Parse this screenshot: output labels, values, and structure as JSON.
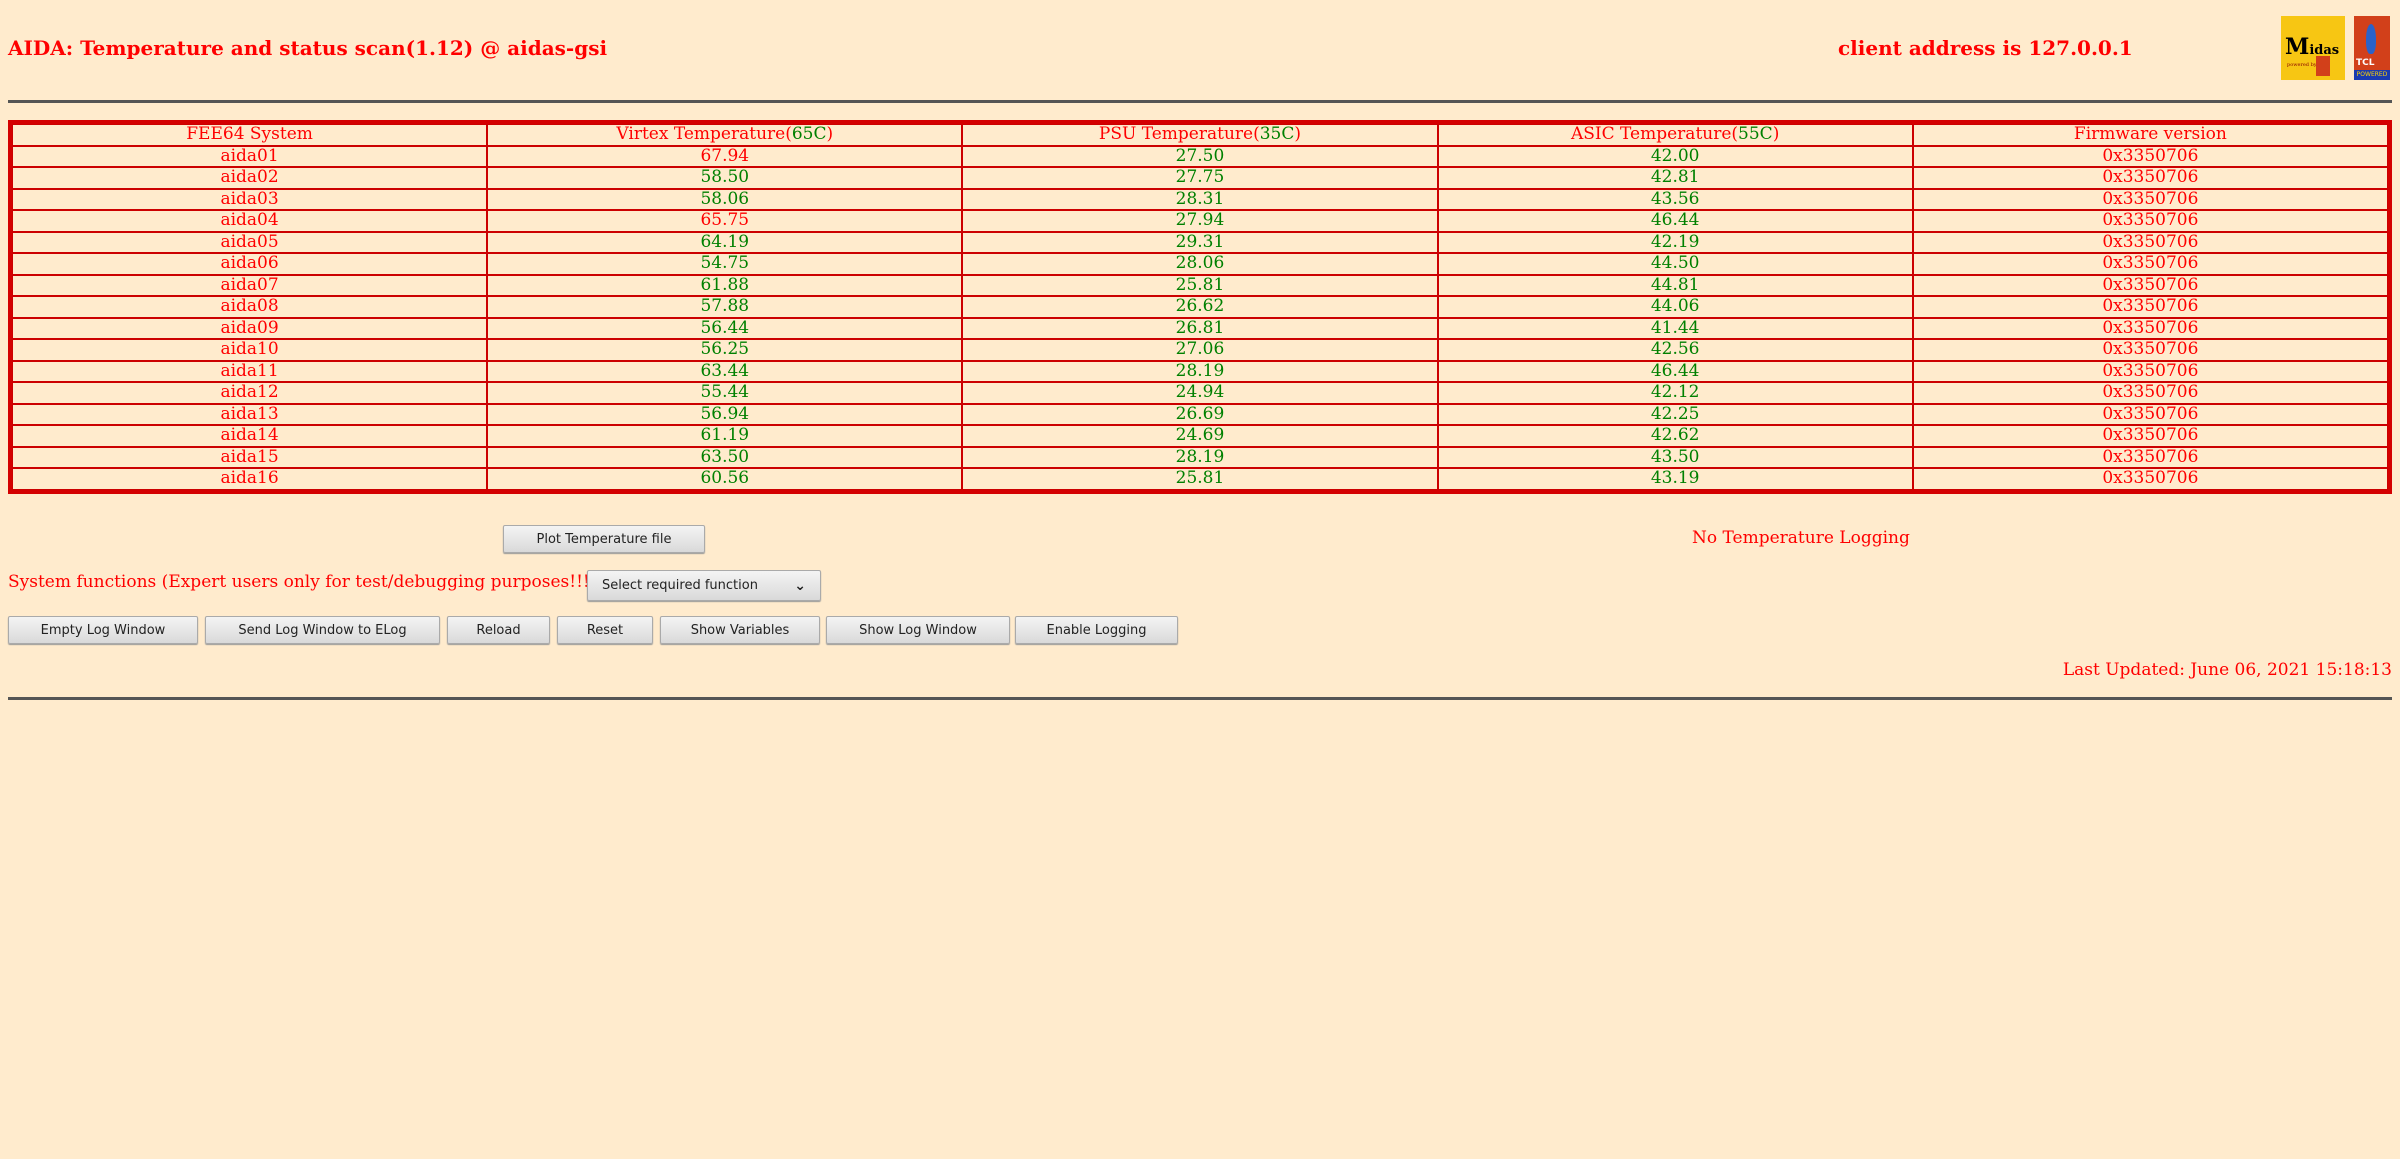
{
  "header": {
    "title": "AIDA: Temperature and status scan(1.12) @ aidas-gsi",
    "client": "client address is 127.0.0.1",
    "logos": [
      "Midas powered by",
      "TCL POWERED"
    ]
  },
  "table": {
    "columns": [
      {
        "label": "FEE64 System",
        "limit": ""
      },
      {
        "label": "Virtex Temperature(",
        "limit": "65C"
      },
      {
        "label": "PSU Temperature(",
        "limit": "35C"
      },
      {
        "label": "ASIC Temperature(",
        "limit": "55C"
      },
      {
        "label": "Firmware version",
        "limit": ""
      }
    ],
    "rows": [
      {
        "system": "aida01",
        "virtex": "67.94",
        "psu": "27.50",
        "asic": "42.00",
        "fw": "0x3350706",
        "virtex_alarm": true
      },
      {
        "system": "aida02",
        "virtex": "58.50",
        "psu": "27.75",
        "asic": "42.81",
        "fw": "0x3350706",
        "virtex_alarm": false
      },
      {
        "system": "aida03",
        "virtex": "58.06",
        "psu": "28.31",
        "asic": "43.56",
        "fw": "0x3350706",
        "virtex_alarm": false
      },
      {
        "system": "aida04",
        "virtex": "65.75",
        "psu": "27.94",
        "asic": "46.44",
        "fw": "0x3350706",
        "virtex_alarm": true
      },
      {
        "system": "aida05",
        "virtex": "64.19",
        "psu": "29.31",
        "asic": "42.19",
        "fw": "0x3350706",
        "virtex_alarm": false
      },
      {
        "system": "aida06",
        "virtex": "54.75",
        "psu": "28.06",
        "asic": "44.50",
        "fw": "0x3350706",
        "virtex_alarm": false
      },
      {
        "system": "aida07",
        "virtex": "61.88",
        "psu": "25.81",
        "asic": "44.81",
        "fw": "0x3350706",
        "virtex_alarm": false
      },
      {
        "system": "aida08",
        "virtex": "57.88",
        "psu": "26.62",
        "asic": "44.06",
        "fw": "0x3350706",
        "virtex_alarm": false
      },
      {
        "system": "aida09",
        "virtex": "56.44",
        "psu": "26.81",
        "asic": "41.44",
        "fw": "0x3350706",
        "virtex_alarm": false
      },
      {
        "system": "aida10",
        "virtex": "56.25",
        "psu": "27.06",
        "asic": "42.56",
        "fw": "0x3350706",
        "virtex_alarm": false
      },
      {
        "system": "aida11",
        "virtex": "63.44",
        "psu": "28.19",
        "asic": "46.44",
        "fw": "0x3350706",
        "virtex_alarm": false
      },
      {
        "system": "aida12",
        "virtex": "55.44",
        "psu": "24.94",
        "asic": "42.12",
        "fw": "0x3350706",
        "virtex_alarm": false
      },
      {
        "system": "aida13",
        "virtex": "56.94",
        "psu": "26.69",
        "asic": "42.25",
        "fw": "0x3350706",
        "virtex_alarm": false
      },
      {
        "system": "aida14",
        "virtex": "61.19",
        "psu": "24.69",
        "asic": "42.62",
        "fw": "0x3350706",
        "virtex_alarm": false
      },
      {
        "system": "aida15",
        "virtex": "63.50",
        "psu": "28.19",
        "asic": "43.50",
        "fw": "0x3350706",
        "virtex_alarm": false
      },
      {
        "system": "aida16",
        "virtex": "60.56",
        "psu": "25.81",
        "asic": "43.19",
        "fw": "0x3350706",
        "virtex_alarm": false
      }
    ]
  },
  "plot_button": "Plot Temperature file",
  "logging_status": "No Temperature Logging",
  "system_functions": {
    "label": "System functions (Expert users only for test/debugging purposes!!!)",
    "select": "Select required function"
  },
  "buttons": [
    "Empty Log Window",
    "Send Log Window to ELog",
    "Reload",
    "Reset",
    "Show Variables",
    "Show Log Window",
    "Enable Logging"
  ],
  "last_updated": "Last Updated: June 06, 2021 15:18:13",
  "colors": {
    "bg": "#ffebcd",
    "alarm": "#ff0000",
    "ok": "#008000"
  }
}
